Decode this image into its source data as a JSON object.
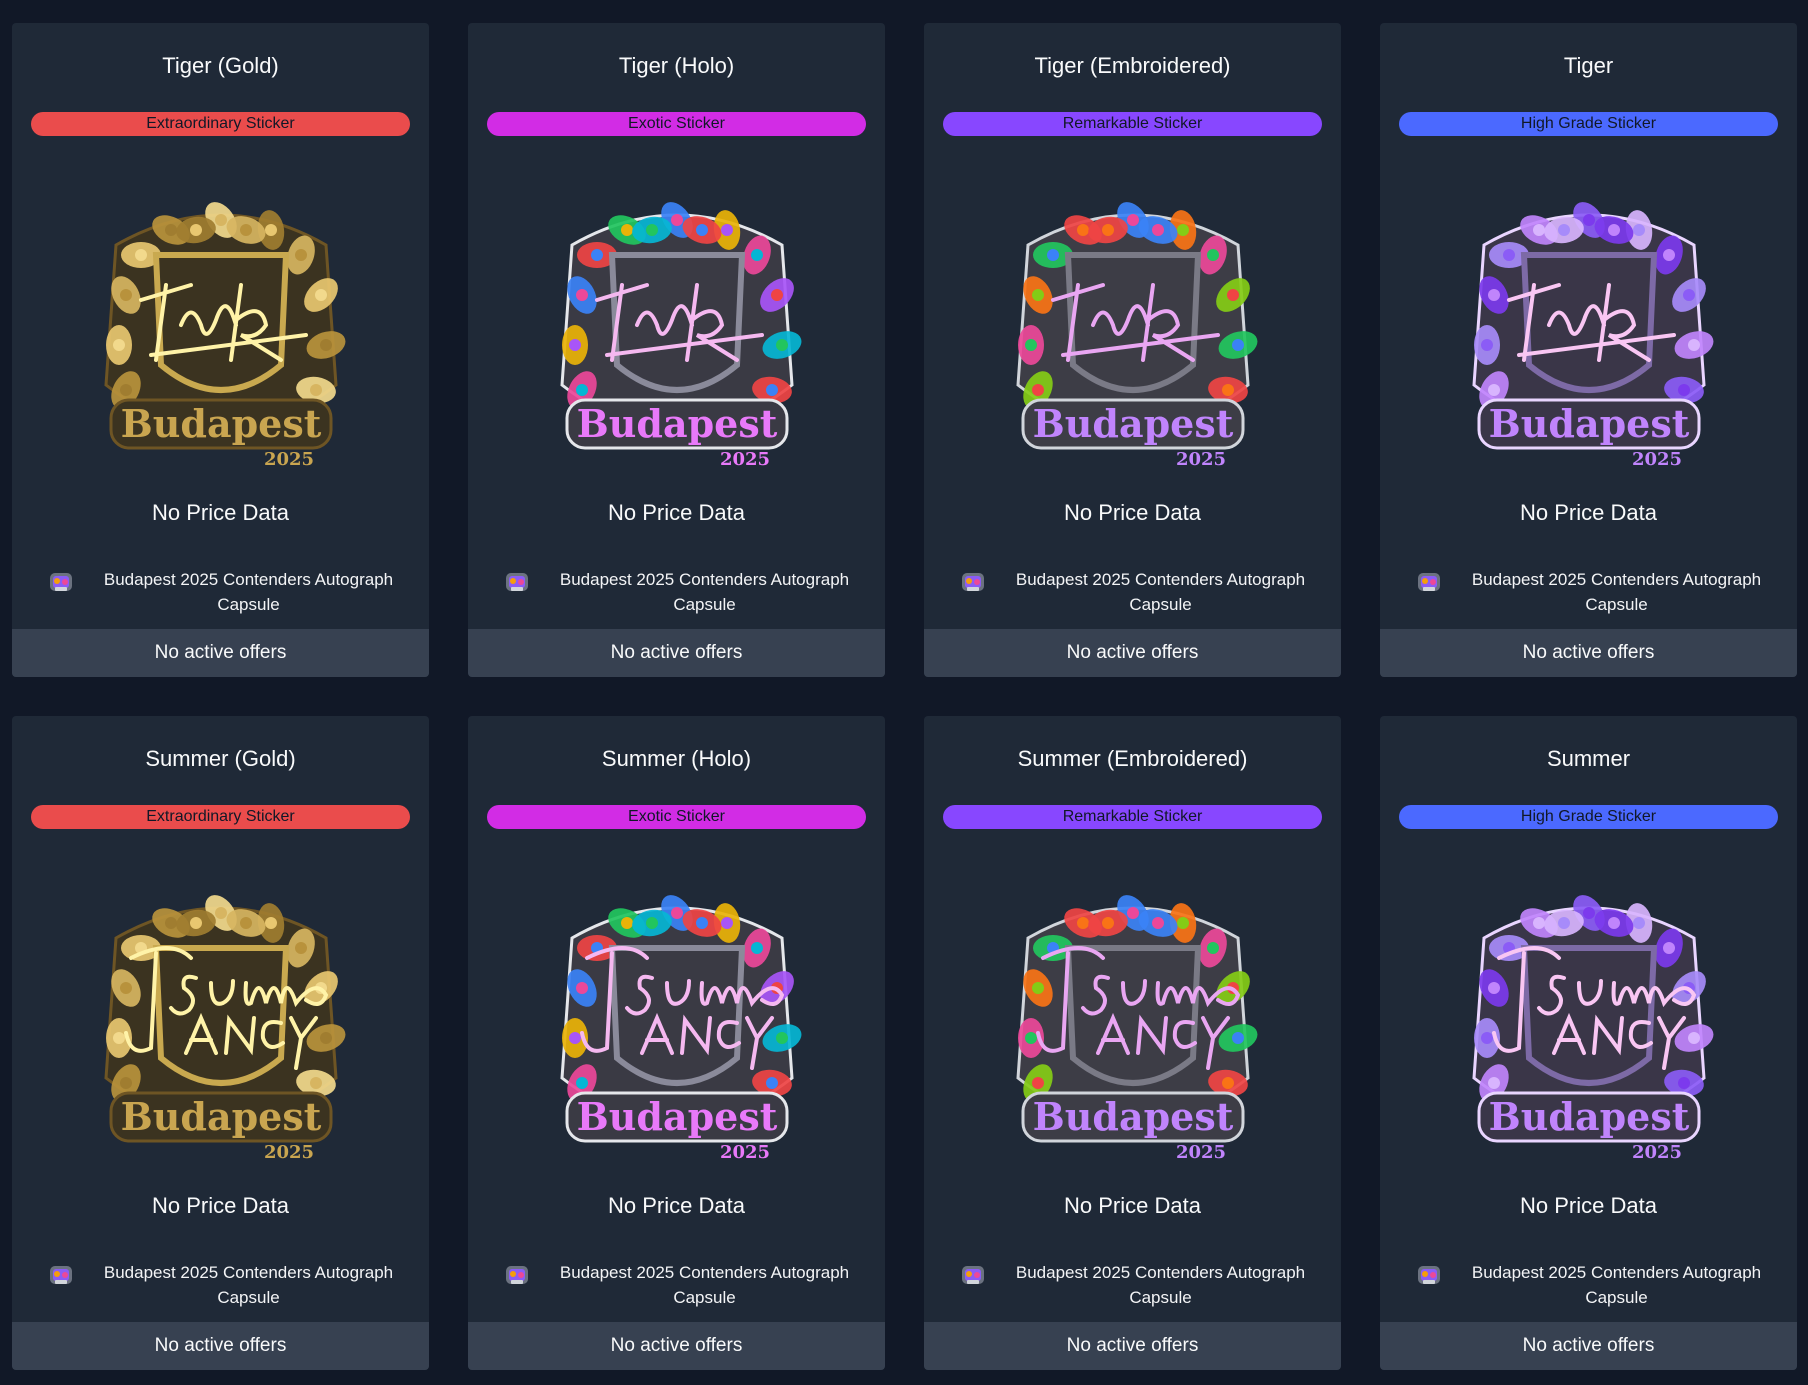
{
  "cards": [
    {
      "title": "Tiger (Gold)",
      "rarity": "Extraordinary Sticker",
      "rarity_color": "#ea4c4c",
      "finish": "gold",
      "signature": "Tiger",
      "price": "No Price Data",
      "collection": "Budapest 2025 Contenders Autograph Capsule",
      "offers": "No active offers",
      "icon": "capsule-icon"
    },
    {
      "title": "Tiger (Holo)",
      "rarity": "Exotic Sticker",
      "rarity_color": "#d22ce5",
      "finish": "holo",
      "signature": "Tiger",
      "price": "No Price Data",
      "collection": "Budapest 2025 Contenders Autograph Capsule",
      "offers": "No active offers",
      "icon": "capsule-icon"
    },
    {
      "title": "Tiger (Embroidered)",
      "rarity": "Remarkable Sticker",
      "rarity_color": "#8847ff",
      "finish": "embroidered",
      "signature": "Tiger",
      "price": "No Price Data",
      "collection": "Budapest 2025 Contenders Autograph Capsule",
      "offers": "No active offers",
      "icon": "capsule-icon"
    },
    {
      "title": "Tiger",
      "rarity": "High Grade Sticker",
      "rarity_color": "#4b69ff",
      "finish": "paper",
      "signature": "Tiger",
      "price": "No Price Data",
      "collection": "Budapest 2025 Contenders Autograph Capsule",
      "offers": "No active offers",
      "icon": "capsule-icon"
    },
    {
      "title": "Summer (Gold)",
      "rarity": "Extraordinary Sticker",
      "rarity_color": "#ea4c4c",
      "finish": "gold",
      "signature": "Summer",
      "price": "No Price Data",
      "collection": "Budapest 2025 Contenders Autograph Capsule",
      "offers": "No active offers",
      "icon": "capsule-icon"
    },
    {
      "title": "Summer (Holo)",
      "rarity": "Exotic Sticker",
      "rarity_color": "#d22ce5",
      "finish": "holo",
      "signature": "Summer",
      "price": "No Price Data",
      "collection": "Budapest 2025 Contenders Autograph Capsule",
      "offers": "No active offers",
      "icon": "capsule-icon"
    },
    {
      "title": "Summer (Embroidered)",
      "rarity": "Remarkable Sticker",
      "rarity_color": "#8847ff",
      "finish": "embroidered",
      "signature": "Summer",
      "price": "No Price Data",
      "collection": "Budapest 2025 Contenders Autograph Capsule",
      "offers": "No active offers",
      "icon": "capsule-icon"
    },
    {
      "title": "Summer",
      "rarity": "High Grade Sticker",
      "rarity_color": "#4b69ff",
      "finish": "paper",
      "signature": "Summer",
      "price": "No Price Data",
      "collection": "Budapest 2025 Contenders Autograph Capsule",
      "offers": "No active offers",
      "icon": "capsule-icon"
    }
  ]
}
